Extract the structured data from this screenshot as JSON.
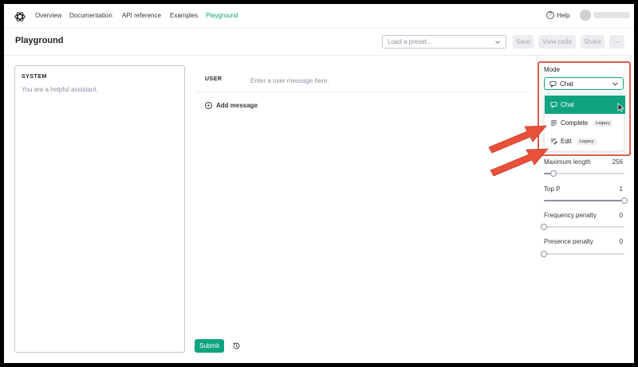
{
  "nav": {
    "links": [
      "Overview",
      "Documentation",
      "API reference",
      "Examples",
      "Playground"
    ],
    "active": "Playground",
    "help_label": "Help"
  },
  "header": {
    "title": "Playground",
    "preset_placeholder": "Load a preset...",
    "save_label": "Save",
    "view_code_label": "View code",
    "share_label": "Share",
    "more_label": "···"
  },
  "system": {
    "label": "SYSTEM",
    "placeholder": "You are a helpful assistant."
  },
  "chat": {
    "user_label": "USER",
    "user_placeholder": "Enter a user message here.",
    "add_message_label": "Add message",
    "submit_label": "Submit"
  },
  "mode": {
    "label": "Mode",
    "selected": "Chat",
    "options": [
      {
        "label": "Chat",
        "badge": ""
      },
      {
        "label": "Complete",
        "badge": "Legacy"
      },
      {
        "label": "Edit",
        "badge": "Legacy"
      }
    ]
  },
  "settings": [
    {
      "label": "Maximum length",
      "value": "256",
      "fraction": 0.12
    },
    {
      "label": "Top P",
      "value": "1",
      "fraction": 1.0
    },
    {
      "label": "Frequency penalty",
      "value": "0",
      "fraction": 0.0
    },
    {
      "label": "Presence penalty",
      "value": "0",
      "fraction": 0.0
    }
  ],
  "colors": {
    "accent": "#10a37f",
    "annotation": "#e8503a",
    "highlight_border": "#d95f4d"
  }
}
